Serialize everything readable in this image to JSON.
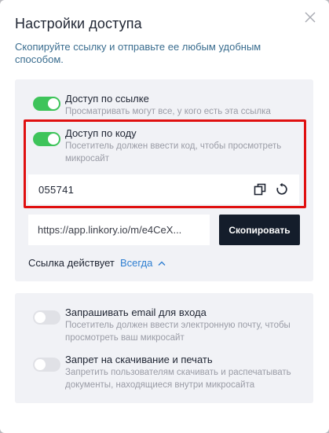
{
  "dialog": {
    "title": "Настройки доступа",
    "subtitle": "Скопируйте ссылку и отправьте ее любым удобным способом."
  },
  "access_link": {
    "title": "Доступ по ссылке",
    "description": "Просматривать могут все, у кого есть эта ссылка",
    "enabled": true
  },
  "access_code": {
    "title": "Доступ по коду",
    "description": "Посетитель должен ввести код, чтобы просмотреть микросайт",
    "enabled": true,
    "code": "055741"
  },
  "share": {
    "url": "https://app.linkory.io/m/e4CeX...",
    "copy_label": "Скопировать",
    "validity_label": "Ссылка действует",
    "validity_value": "Всегда"
  },
  "email_login": {
    "title": "Запрашивать email для входа",
    "description": "Посетитель должен ввести электронную почту, чтобы просмотреть ваш микросайт",
    "enabled": false
  },
  "download_ban": {
    "title": "Запрет на скачивание и печать",
    "description": "Запретить пользователям скачивать и распечатывать документы, находящиеся внутри микросайта",
    "enabled": false
  },
  "colors": {
    "toggle_on": "#3ec45a",
    "toggle_off": "#e0e1e6",
    "primary_button": "#141d2b",
    "link": "#2f7fd1",
    "highlight": "#e01010"
  }
}
